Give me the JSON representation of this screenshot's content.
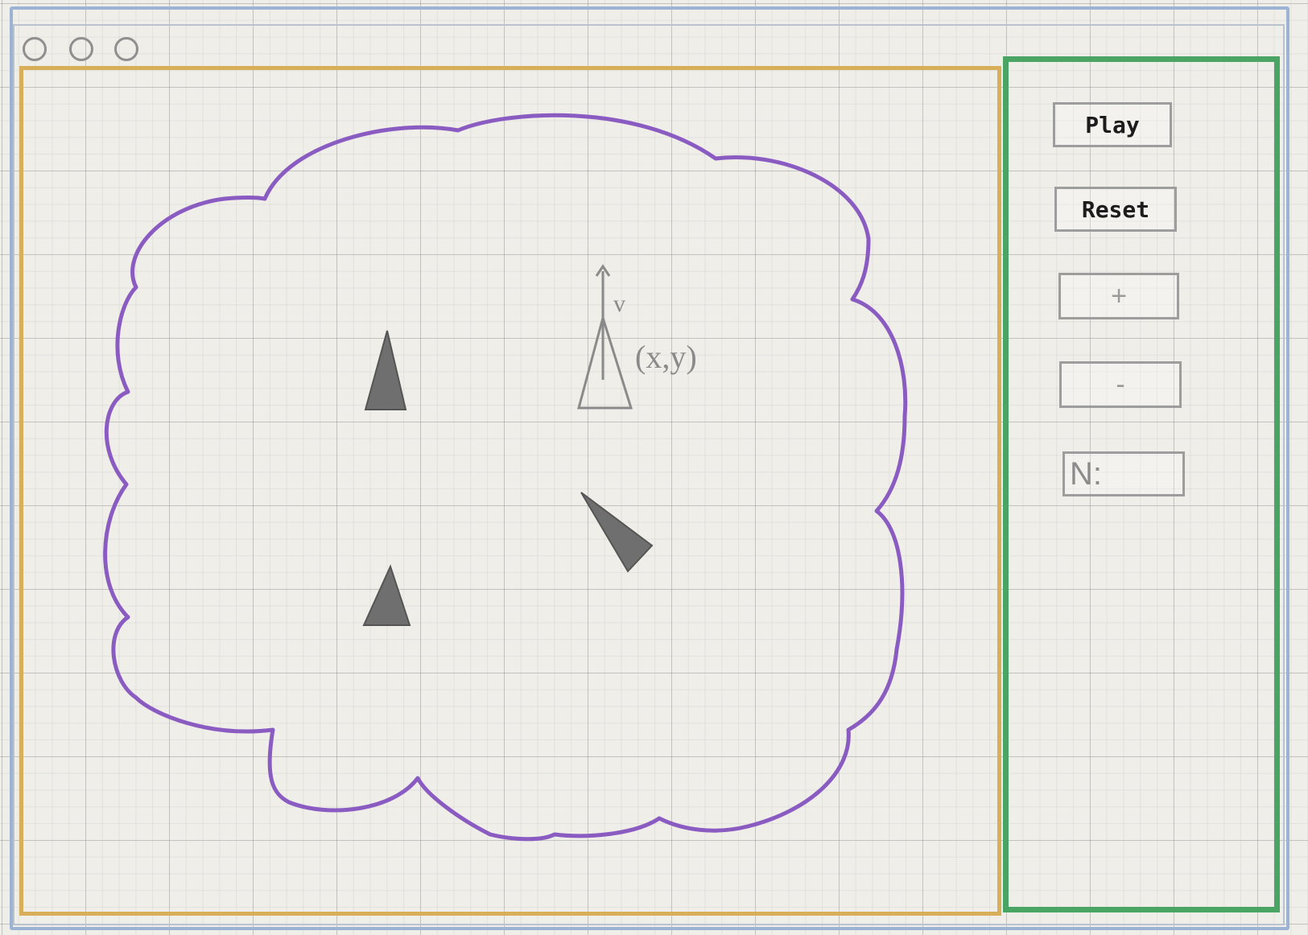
{
  "window": {
    "traffic_lights": [
      "close-circle",
      "minimize-circle",
      "maximize-circle"
    ],
    "frame_color": "#9db3d3"
  },
  "game_area": {
    "border_color": "#d8ae5a",
    "boundary_color": "#8a5cc2",
    "agents": [
      {
        "name": "agent-1",
        "fill": "#6f6f6f"
      },
      {
        "name": "agent-2",
        "fill": "#6f6f6f"
      },
      {
        "name": "agent-3",
        "fill": "#6f6f6f"
      }
    ],
    "annotated_agent": {
      "velocity_label": "v",
      "position_label": "(x,y)"
    }
  },
  "control_panel": {
    "border_color": "#4aa564",
    "play_label": "Play",
    "reset_label": "Reset",
    "plus_label": "+",
    "minus_label": "-",
    "n_label": "N:",
    "n_value": ""
  }
}
